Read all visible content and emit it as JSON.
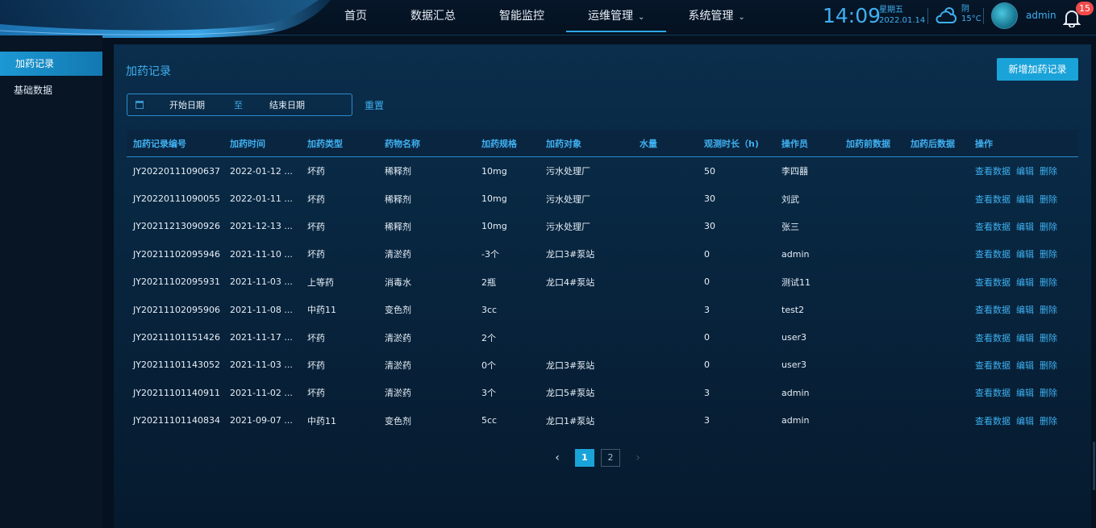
{
  "header": {
    "nav": [
      {
        "label": "首页",
        "chevron": false,
        "active": false
      },
      {
        "label": "数据汇总",
        "chevron": false,
        "active": false
      },
      {
        "label": "智能监控",
        "chevron": false,
        "active": false
      },
      {
        "label": "运维管理",
        "chevron": true,
        "active": true
      },
      {
        "label": "系统管理",
        "chevron": true,
        "active": false
      }
    ],
    "time": "14:09",
    "weekday": "星期五",
    "date": "2022.01.14",
    "weather": "阴",
    "temperature": "15°C",
    "user": "admin",
    "notification_count": "15"
  },
  "sidebar": {
    "items": [
      {
        "label": "加药记录",
        "active": true
      },
      {
        "label": "基础数据",
        "active": false
      }
    ]
  },
  "main": {
    "title": "加药记录",
    "add_button": "新增加药记录",
    "filter": {
      "start_placeholder": "开始日期",
      "separator": "至",
      "end_placeholder": "结束日期",
      "reset": "重置"
    },
    "columns": [
      "加药记录编号",
      "加药时间",
      "加药类型",
      "药物名称",
      "加药规格",
      "加药对象",
      "水量",
      "观测时长（h)",
      "操作员",
      "加药前数据",
      "加药后数据",
      "操作"
    ],
    "row_actions": [
      "查看数据",
      "编辑",
      "删除"
    ],
    "rows": [
      [
        "JY20220111090637",
        "2022-01-12 ...",
        "坏药",
        "稀释剂",
        "10mg",
        "污水处理厂",
        "",
        "50",
        "李四囍",
        "",
        ""
      ],
      [
        "JY20220111090055",
        "2022-01-11 ...",
        "坏药",
        "稀释剂",
        "10mg",
        "污水处理厂",
        "",
        "30",
        "刘武",
        "",
        ""
      ],
      [
        "JY20211213090926",
        "2021-12-13 ...",
        "坏药",
        "稀释剂",
        "10mg",
        "污水处理厂",
        "",
        "30",
        "张三",
        "",
        ""
      ],
      [
        "JY20211102095946",
        "2021-11-10 ...",
        "坏药",
        "清淤药",
        "-3个",
        "龙口3#泵站",
        "",
        "0",
        "admin",
        "",
        ""
      ],
      [
        "JY20211102095931",
        "2021-11-03 ...",
        "上等药",
        "消毒水",
        "2瓶",
        "龙口4#泵站",
        "",
        "0",
        "测试11",
        "",
        ""
      ],
      [
        "JY20211102095906",
        "2021-11-08 ...",
        "中药11",
        "变色剂",
        "3cc",
        "",
        "",
        "3",
        "test2",
        "",
        ""
      ],
      [
        "JY20211101151426",
        "2021-11-17 ...",
        "坏药",
        "清淤药",
        "2个",
        "",
        "",
        "0",
        "user3",
        "",
        ""
      ],
      [
        "JY20211101143052",
        "2021-11-03 ...",
        "坏药",
        "清淤药",
        "0个",
        "龙口3#泵站",
        "",
        "0",
        "user3",
        "",
        ""
      ],
      [
        "JY20211101140911",
        "2021-11-02 ...",
        "坏药",
        "清淤药",
        "3个",
        "龙口5#泵站",
        "",
        "3",
        "admin",
        "",
        ""
      ],
      [
        "JY20211101140834",
        "2021-09-07 ...",
        "中药11",
        "变色剂",
        "5cc",
        "龙口1#泵站",
        "",
        "3",
        "admin",
        "",
        ""
      ]
    ],
    "pagination": {
      "pages": [
        "1",
        "2"
      ],
      "current": "1",
      "prev": "‹",
      "next": "›"
    }
  },
  "colors": {
    "accent": "#3fb0f0",
    "button": "#1aa3d9",
    "badge": "#f04a4a",
    "background": "#05111e"
  }
}
